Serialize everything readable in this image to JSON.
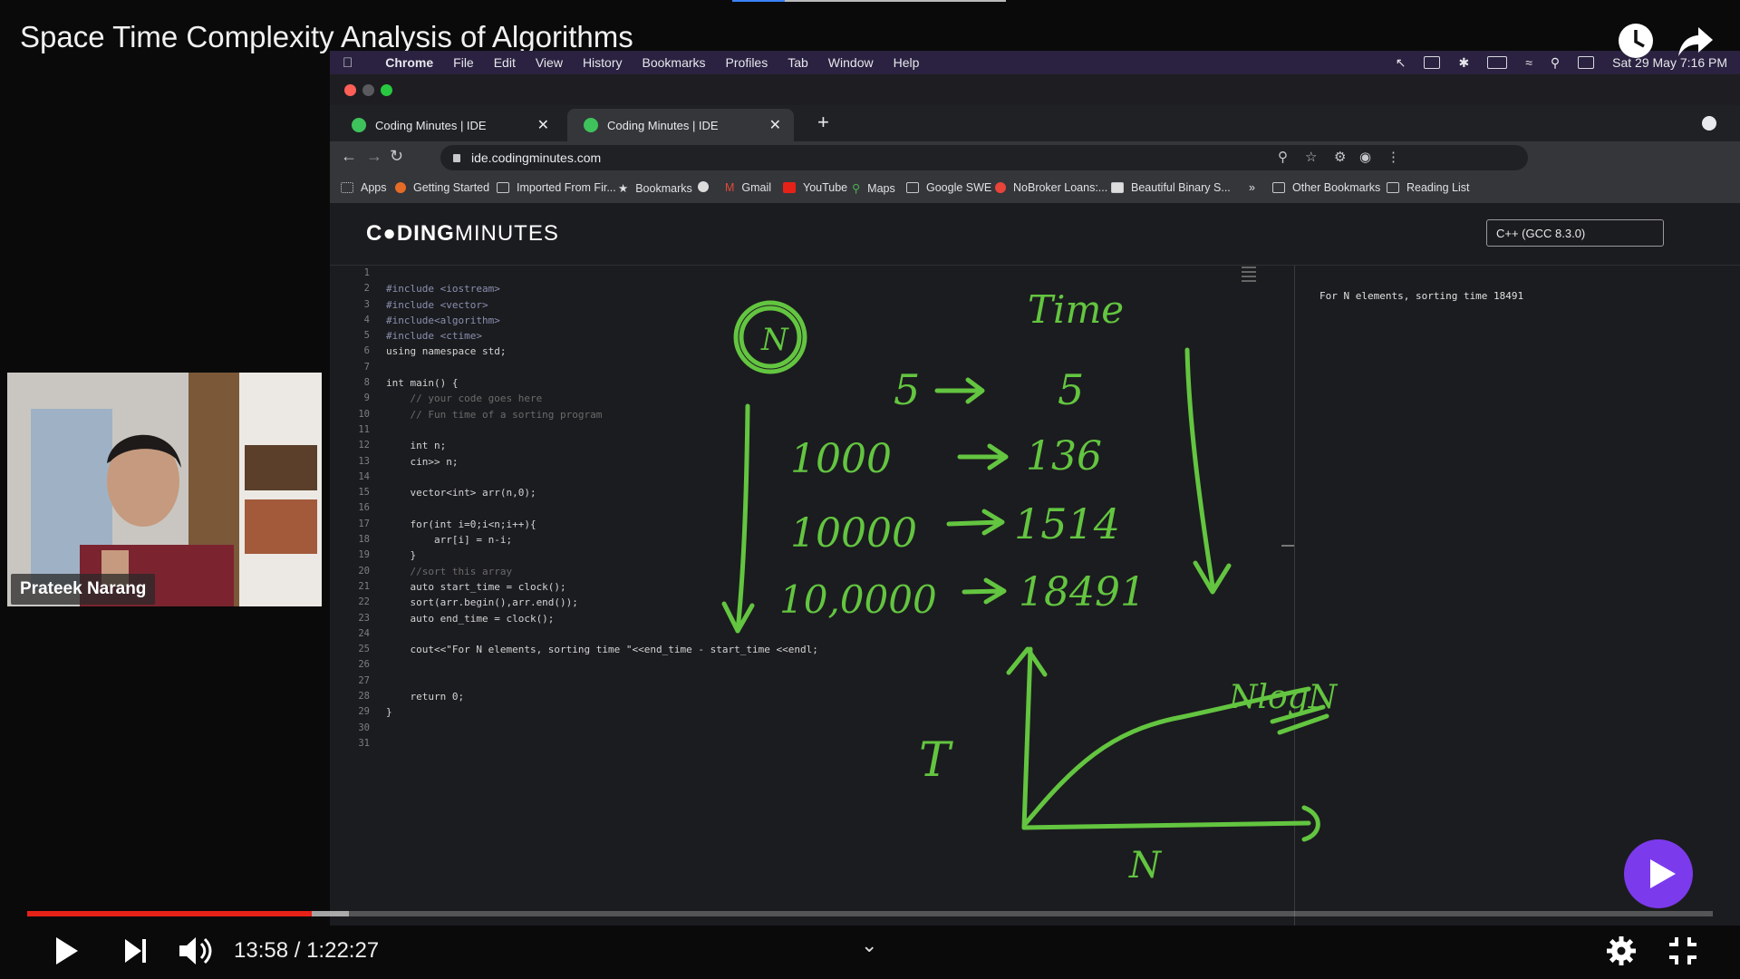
{
  "player": {
    "video_title": "Space Time Complexity Analysis of Algorithms",
    "time_current": "13:58",
    "time_separator": " / ",
    "time_total": "1:22:27",
    "progress_fraction": 0.169,
    "buffered_fraction": 0.191,
    "presenter_name": "Prateek Narang",
    "progress_color": "#e62117"
  },
  "mac_menubar": {
    "app": "Chrome",
    "items": [
      "File",
      "Edit",
      "View",
      "History",
      "Bookmarks",
      "Profiles",
      "Tab",
      "Window",
      "Help"
    ],
    "datetime": "Sat 29 May  7:16 PM"
  },
  "browser": {
    "tabs": [
      {
        "title": "Coding Minutes | IDE"
      },
      {
        "title": "Coding Minutes | IDE"
      }
    ],
    "url": "ide.codingminutes.com",
    "bookmarks": [
      "Apps",
      "Getting Started",
      "Imported From Fir...",
      "Bookmarks",
      "Gmail",
      "YouTube",
      "Maps",
      "Google SWE",
      "NoBroker Loans:...",
      "Beautiful Binary S..."
    ],
    "other_bookmarks": "Other Bookmarks",
    "reading_list": "Reading List",
    "overflow": "»"
  },
  "ide": {
    "logo_bold": "C●DING",
    "logo_light": "MINUTES",
    "language": "C++ (GCC 8.3.0)",
    "output": "For N elements, sorting time 18491",
    "line_numbers": [
      "1",
      "2",
      "3",
      "4",
      "5",
      "6",
      "7",
      "8",
      "9",
      "10",
      "11",
      "12",
      "13",
      "14",
      "15",
      "16",
      "17",
      "18",
      "19",
      "20",
      "21",
      "22",
      "23",
      "24",
      "25",
      "26",
      "27",
      "28",
      "29",
      "30",
      "31"
    ],
    "code": [
      "",
      "#include <iostream>",
      "#include <vector>",
      "#include<algorithm>",
      "#include <ctime>",
      "using namespace std;",
      "",
      "int main() {",
      "    // your code goes here",
      "    // Fun time of a sorting program",
      "",
      "    int n;",
      "    cin>> n;",
      "",
      "    vector<int> arr(n,0);",
      "",
      "    for(int i=0;i<n;i++){",
      "        arr[i] = n-i;",
      "    }",
      "    //sort this array",
      "    auto start_time = clock();",
      "    sort(arr.begin(),arr.end());",
      "    auto end_time = clock();",
      "",
      "    cout<<\"For N elements, sorting time \"<<end_time - start_time <<endl;",
      "",
      "",
      "    return 0;",
      "}",
      "",
      ""
    ]
  },
  "annotations": {
    "n_circle": "N",
    "time_header": "Time",
    "rows": [
      {
        "n": "5",
        "t": "5"
      },
      {
        "n": "1000",
        "t": "136"
      },
      {
        "n": "10000",
        "t": "1514"
      },
      {
        "n": "10,0000",
        "t": "18491"
      }
    ],
    "graph_y_label": "T",
    "graph_x_label": "N",
    "graph_curve_label": "NlogN",
    "ink_color": "#63c540"
  }
}
